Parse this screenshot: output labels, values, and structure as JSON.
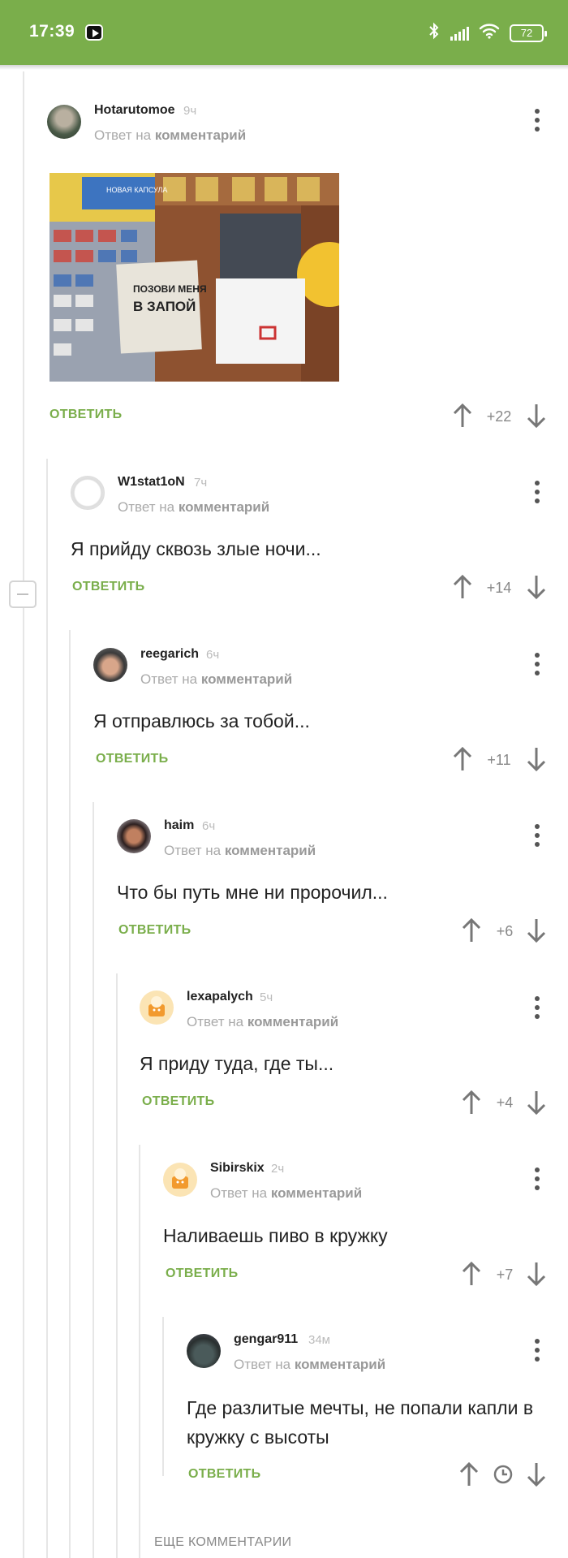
{
  "status_bar": {
    "time": "17:39",
    "battery": "72"
  },
  "ui": {
    "reply_prefix": "Ответ на",
    "reply_target": "комментарий",
    "answer_label": "ОТВЕТИТЬ",
    "more_comments": "ЕЩЕ КОММЕНТАРИИ"
  },
  "comments": [
    {
      "author": "Hotarutomoe",
      "time": "9ч",
      "text": "",
      "score": "+22"
    },
    {
      "author": "W1stat1oN",
      "time": "7ч",
      "text": "Я прийду сквозь злые ночи...",
      "score": "+14"
    },
    {
      "author": "reegarich",
      "time": "6ч",
      "text": "Я отправлюсь за тобой...",
      "score": "+11"
    },
    {
      "author": "haim",
      "time": "6ч",
      "text": "Что бы путь мне ни пророчил...",
      "score": "+6"
    },
    {
      "author": "lexapalych",
      "time": "5ч",
      "text": "Я приду туда, где ты...",
      "score": "+4"
    },
    {
      "author": "Sibirskix",
      "time": "2ч",
      "text": "Наливаешь пиво в кружку",
      "score": "+7"
    },
    {
      "author": "gengar911",
      "time": "34м",
      "text": "Где разлитые мечты, не попали капли в кружку с высоты",
      "score": ""
    }
  ],
  "image": {
    "label_bag_line1": "ПОЗОВИ МЕНЯ",
    "label_bag_line2": "В ЗАПОЙ",
    "label_sign": "НОВАЯ КАПСУЛА"
  },
  "icons": {
    "kebab": "kebab-menu-icon",
    "up": "arrow-up-icon",
    "down": "arrow-down-icon",
    "clock": "clock-icon"
  }
}
